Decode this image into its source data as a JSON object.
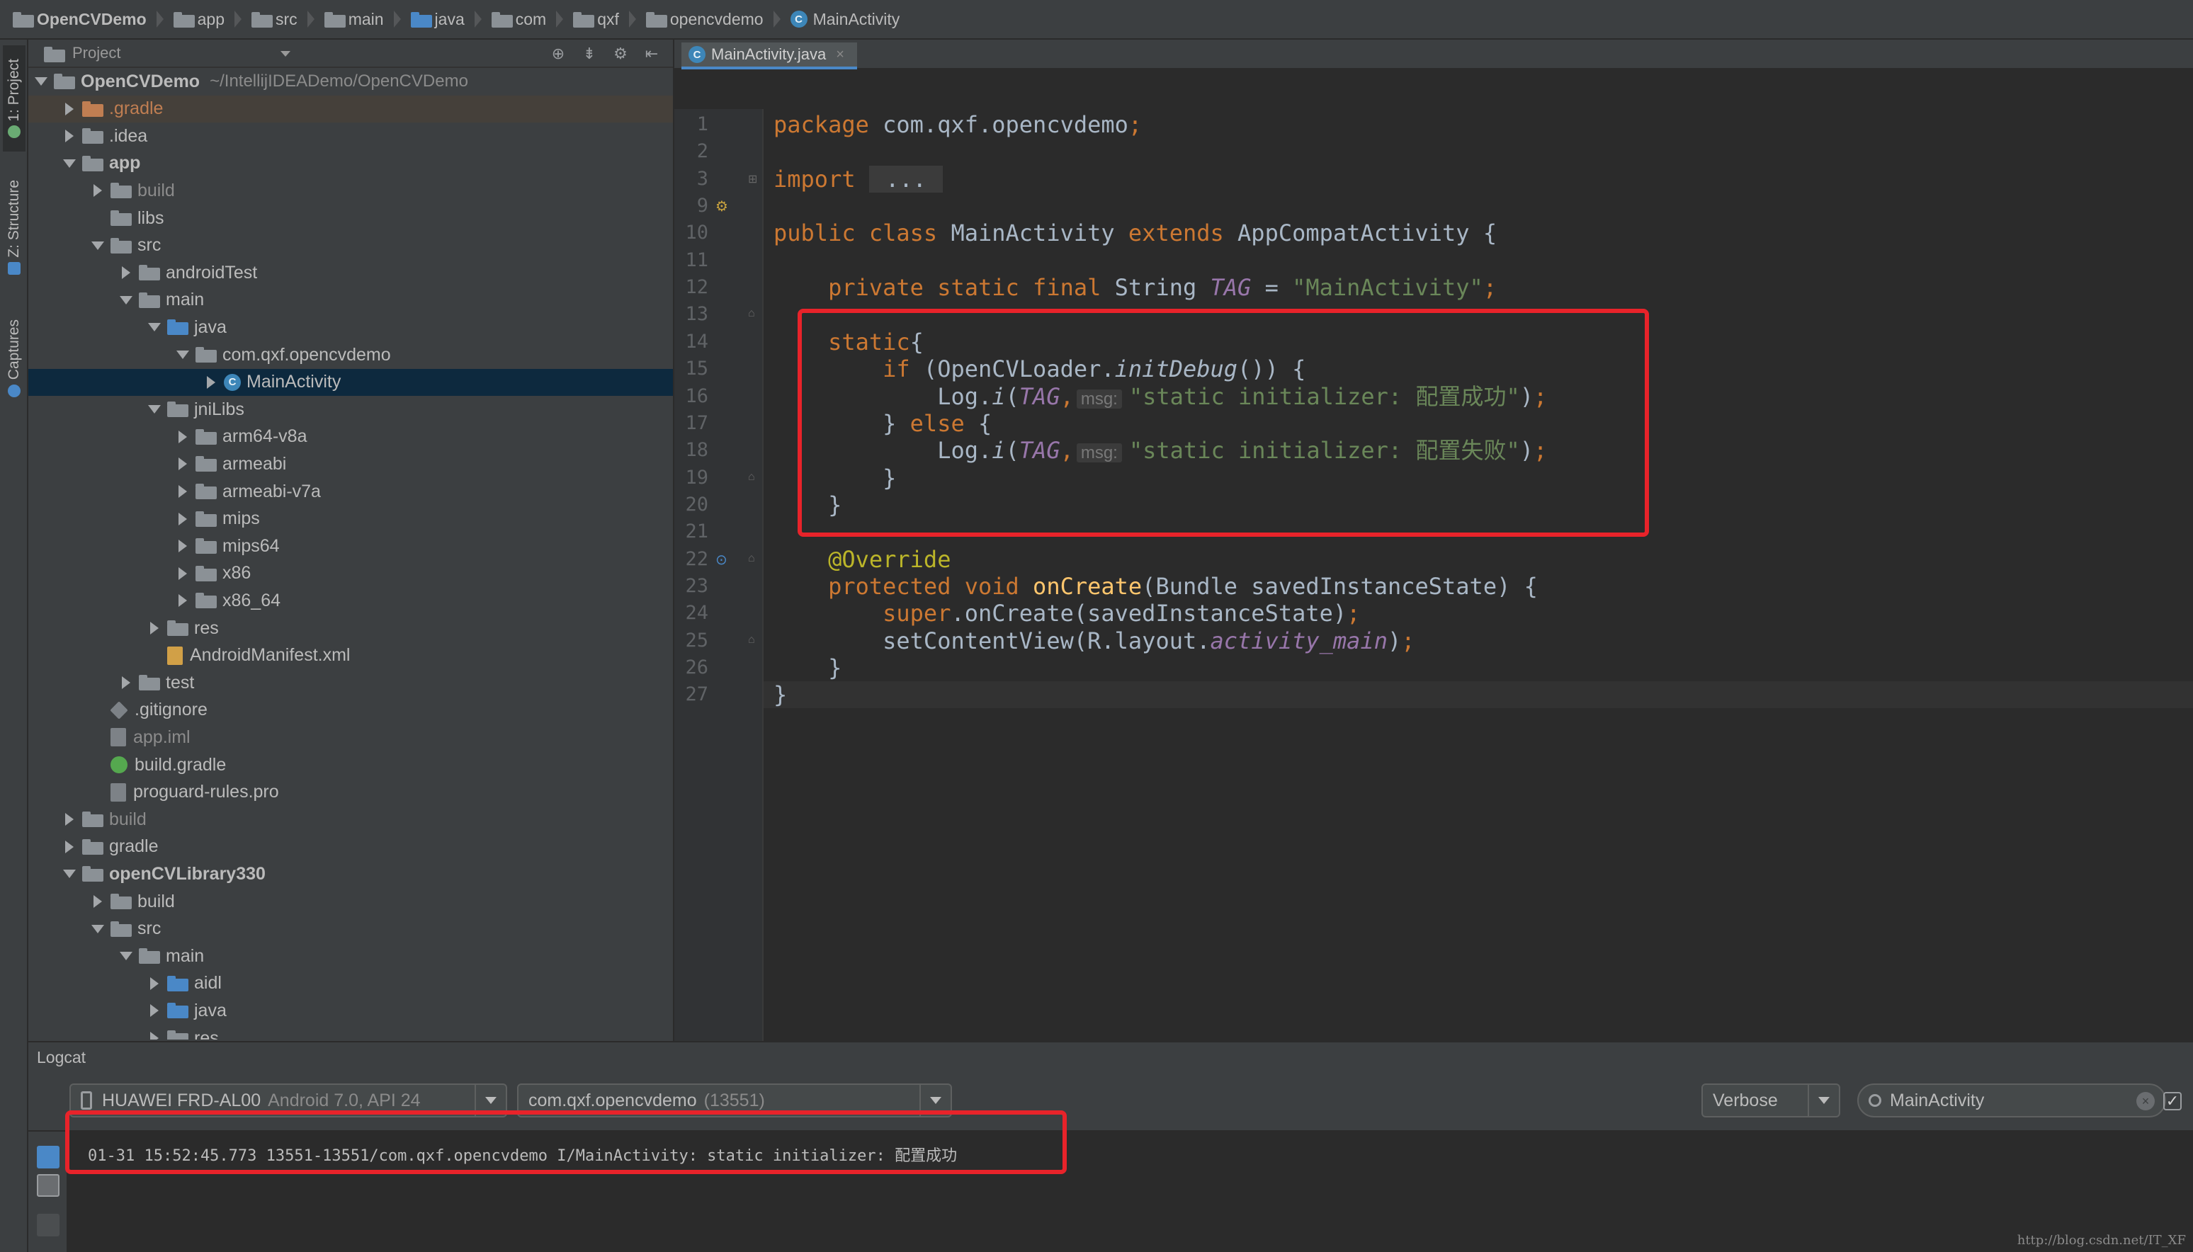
{
  "breadcrumbs": [
    "OpenCVDemo",
    "app",
    "src",
    "main",
    "java",
    "com",
    "qxf",
    "opencvdemo",
    "MainActivity"
  ],
  "left_strip": {
    "project_tab": "1: Project",
    "structure_tab": "Z: Structure",
    "captures_tab": "Captures"
  },
  "project_panel": {
    "title": "Project",
    "tree": [
      {
        "label": "OpenCVDemo",
        "path": "~/IntellijIDEADemo/OpenCVDemo",
        "level": 0,
        "expanded": true,
        "icon": "module-folder",
        "bold": true
      },
      {
        "label": ".gradle",
        "level": 1,
        "expanded": false,
        "icon": "folder-orange",
        "style": "orange",
        "highlight": true
      },
      {
        "label": ".idea",
        "level": 1,
        "expanded": false,
        "icon": "folder-gray"
      },
      {
        "label": "app",
        "level": 1,
        "expanded": true,
        "icon": "module-folder",
        "bold": true
      },
      {
        "label": "build",
        "level": 2,
        "expanded": false,
        "icon": "folder-gray",
        "style": "dim"
      },
      {
        "label": "libs",
        "level": 2,
        "icon": "folder-gray"
      },
      {
        "label": "src",
        "level": 2,
        "expanded": true,
        "icon": "folder-gray"
      },
      {
        "label": "androidTest",
        "level": 3,
        "expanded": false,
        "icon": "folder-gray"
      },
      {
        "label": "main",
        "level": 3,
        "expanded": true,
        "icon": "folder-gray"
      },
      {
        "label": "java",
        "level": 4,
        "expanded": true,
        "icon": "folder-blue"
      },
      {
        "label": "com.qxf.opencvdemo",
        "level": 5,
        "expanded": true,
        "icon": "package"
      },
      {
        "label": "MainActivity",
        "level": 6,
        "expanded": false,
        "icon": "class-c",
        "selected": true
      },
      {
        "label": "jniLibs",
        "level": 4,
        "expanded": true,
        "icon": "folder-gray"
      },
      {
        "label": "arm64-v8a",
        "level": 5,
        "expanded": false,
        "icon": "folder-gray"
      },
      {
        "label": "armeabi",
        "level": 5,
        "expanded": false,
        "icon": "folder-gray"
      },
      {
        "label": "armeabi-v7a",
        "level": 5,
        "expanded": false,
        "icon": "folder-gray"
      },
      {
        "label": "mips",
        "level": 5,
        "expanded": false,
        "icon": "folder-gray"
      },
      {
        "label": "mips64",
        "level": 5,
        "expanded": false,
        "icon": "folder-gray"
      },
      {
        "label": "x86",
        "level": 5,
        "expanded": false,
        "icon": "folder-gray"
      },
      {
        "label": "x86_64",
        "level": 5,
        "expanded": false,
        "icon": "folder-gray"
      },
      {
        "label": "res",
        "level": 4,
        "expanded": false,
        "icon": "folder-gray"
      },
      {
        "label": "AndroidManifest.xml",
        "level": 4,
        "icon": "xml-file"
      },
      {
        "label": "test",
        "level": 3,
        "expanded": false,
        "icon": "folder-gray"
      },
      {
        "label": ".gitignore",
        "level": 2,
        "icon": "git-file"
      },
      {
        "label": "app.iml",
        "level": 2,
        "icon": "iml-file",
        "style": "dim"
      },
      {
        "label": "build.gradle",
        "level": 2,
        "icon": "gradle-file"
      },
      {
        "label": "proguard-rules.pro",
        "level": 2,
        "icon": "pro-file"
      },
      {
        "label": "build",
        "level": 1,
        "expanded": false,
        "icon": "folder-gray",
        "style": "dim"
      },
      {
        "label": "gradle",
        "level": 1,
        "expanded": false,
        "icon": "folder-gray"
      },
      {
        "label": "openCVLibrary330",
        "level": 1,
        "expanded": true,
        "icon": "module-folder",
        "bold": true
      },
      {
        "label": "build",
        "level": 2,
        "expanded": false,
        "icon": "folder-gray"
      },
      {
        "label": "src",
        "level": 2,
        "expanded": true,
        "icon": "folder-gray"
      },
      {
        "label": "main",
        "level": 3,
        "expanded": true,
        "icon": "folder-gray"
      },
      {
        "label": "aidl",
        "level": 4,
        "expanded": false,
        "icon": "folder-blue"
      },
      {
        "label": "java",
        "level": 4,
        "expanded": false,
        "icon": "folder-blue"
      },
      {
        "label": "res",
        "level": 4,
        "expanded": false,
        "icon": "folder-gray"
      }
    ]
  },
  "editor": {
    "tab_label": "MainActivity.java",
    "line_numbers": [
      "1",
      "2",
      "3",
      "9",
      "10",
      "11",
      "12",
      "13",
      "14",
      "15",
      "16",
      "17",
      "18",
      "19",
      "20",
      "21",
      "22",
      "23",
      "24",
      "25",
      "26",
      "27"
    ],
    "code_lines": [
      {
        "line": "1",
        "tokens": [
          [
            "kw",
            "package "
          ],
          [
            "pl",
            "com.qxf.opencvdemo"
          ],
          [
            "kw",
            ";"
          ]
        ]
      },
      {
        "line": "2",
        "tokens": []
      },
      {
        "line": "3",
        "tokens": [
          [
            "kw",
            "import "
          ],
          [
            "fold",
            " ... "
          ]
        ]
      },
      {
        "line": "9",
        "tokens": []
      },
      {
        "line": "10",
        "tokens": [
          [
            "kw",
            "public class "
          ],
          [
            "pl",
            "MainActivity "
          ],
          [
            "kw",
            "extends "
          ],
          [
            "pl",
            "AppCompatActivity {"
          ]
        ]
      },
      {
        "line": "11",
        "tokens": []
      },
      {
        "line": "12",
        "tokens": [
          [
            "pl",
            "    "
          ],
          [
            "kw",
            "private static final "
          ],
          [
            "pl",
            "String "
          ],
          [
            "it",
            "TAG"
          ],
          [
            "pl",
            " = "
          ],
          [
            "st",
            "\"MainActivity\""
          ],
          [
            "kw",
            ";"
          ]
        ]
      },
      {
        "line": "13",
        "tokens": []
      },
      {
        "line": "14",
        "tokens": [
          [
            "pl",
            "    "
          ],
          [
            "kw",
            "static"
          ],
          [
            "pl",
            "{"
          ]
        ]
      },
      {
        "line": "15",
        "tokens": [
          [
            "pl",
            "        "
          ],
          [
            "kw",
            "if "
          ],
          [
            "pl",
            "(OpenCVLoader."
          ],
          [
            "im",
            "initDebug"
          ],
          [
            "pl",
            "()) {"
          ]
        ]
      },
      {
        "line": "16",
        "tokens": [
          [
            "pl",
            "            Log."
          ],
          [
            "im",
            "i"
          ],
          [
            "pl",
            "("
          ],
          [
            "it",
            "TAG"
          ],
          [
            "kw",
            ","
          ],
          [
            "hint",
            "msg:"
          ],
          [
            "st",
            "\"static initializer: 配置成功\""
          ],
          [
            "pl",
            ")"
          ],
          [
            "kw",
            ";"
          ]
        ]
      },
      {
        "line": "17",
        "tokens": [
          [
            "pl",
            "        } "
          ],
          [
            "kw",
            "else "
          ],
          [
            "pl",
            "{"
          ]
        ]
      },
      {
        "line": "18",
        "tokens": [
          [
            "pl",
            "            Log."
          ],
          [
            "im",
            "i"
          ],
          [
            "pl",
            "("
          ],
          [
            "it",
            "TAG"
          ],
          [
            "kw",
            ","
          ],
          [
            "hint",
            "msg:"
          ],
          [
            "st",
            "\"static initializer: 配置失败\""
          ],
          [
            "pl",
            ")"
          ],
          [
            "kw",
            ";"
          ]
        ]
      },
      {
        "line": "19",
        "tokens": [
          [
            "pl",
            "        }"
          ]
        ]
      },
      {
        "line": "20",
        "tokens": [
          [
            "pl",
            "    }"
          ]
        ]
      },
      {
        "line": "21",
        "tokens": []
      },
      {
        "line": "22",
        "tokens": [
          [
            "pl",
            "    "
          ],
          [
            "an",
            "@Override"
          ]
        ]
      },
      {
        "line": "23",
        "tokens": [
          [
            "pl",
            "    "
          ],
          [
            "kw",
            "protected void "
          ],
          [
            "fn",
            "onCreate"
          ],
          [
            "pl",
            "(Bundle savedInstanceState) {"
          ]
        ]
      },
      {
        "line": "24",
        "tokens": [
          [
            "pl",
            "        "
          ],
          [
            "kw",
            "super"
          ],
          [
            "pl",
            ".onCreate(savedInstanceState)"
          ],
          [
            "kw",
            ";"
          ]
        ]
      },
      {
        "line": "25",
        "tokens": [
          [
            "pl",
            "        setContentView(R.layout."
          ],
          [
            "it",
            "activity_main"
          ],
          [
            "pl",
            ")"
          ],
          [
            "kw",
            ";"
          ]
        ]
      },
      {
        "line": "26",
        "tokens": [
          [
            "pl",
            "    }"
          ]
        ]
      },
      {
        "line": "27",
        "tokens": [
          [
            "pl",
            "}"
          ]
        ]
      }
    ],
    "current_line": "27"
  },
  "logcat": {
    "title": "Logcat",
    "device": "HUAWEI FRD-AL00",
    "device_sub": "Android 7.0, API 24",
    "process": "com.qxf.opencvdemo",
    "process_sub": "(13551)",
    "level": "Verbose",
    "filter": "MainActivity",
    "log_line": "01-31 15:52:45.773 13551-13551/com.qxf.opencvdemo I/MainActivity: static initializer: 配置成功"
  },
  "watermark": "http://blog.csdn.net/IT_XF",
  "colors": {
    "highlight_box": "#e8232a",
    "keyword": "#cc7832",
    "string": "#6a8759",
    "field": "#9876aa",
    "method": "#ffc66d",
    "annotation": "#bbb529",
    "selection": "#0d293e"
  }
}
